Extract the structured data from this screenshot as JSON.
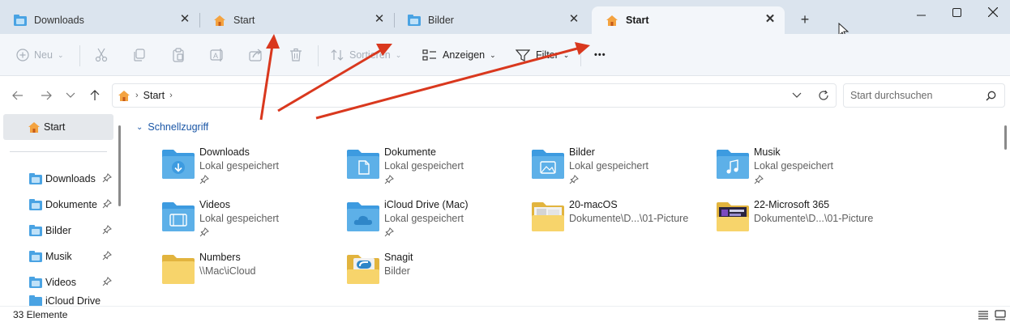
{
  "tabs": [
    {
      "label": "Downloads",
      "icon": "downloads-folder-icon",
      "active": false
    },
    {
      "label": "Start",
      "icon": "home-icon",
      "active": false
    },
    {
      "label": "Bilder",
      "icon": "pictures-folder-icon",
      "active": false
    },
    {
      "label": "Start",
      "icon": "home-icon",
      "active": true
    }
  ],
  "new_tab_label": "+",
  "toolbar": {
    "new_label": "Neu",
    "sort_label": "Sortieren",
    "view_label": "Anzeigen",
    "filter_label": "Filter",
    "more_label": "•••"
  },
  "address": {
    "crumbs": [
      "Start"
    ],
    "search_placeholder": "Start durchsuchen"
  },
  "sidebar": {
    "home_label": "Start",
    "items": [
      {
        "label": "Downloads",
        "pinned": true
      },
      {
        "label": "Dokumente",
        "pinned": true
      },
      {
        "label": "Bilder",
        "pinned": true
      },
      {
        "label": "Musik",
        "pinned": true
      },
      {
        "label": "Videos",
        "pinned": true
      },
      {
        "label": "iCloud Drive",
        "pinned": false
      }
    ]
  },
  "content": {
    "section_title": "Schnellzugriff",
    "tiles": [
      {
        "name": "Downloads",
        "sub": "Lokal gespeichert",
        "icon": "downloads-folder-icon",
        "pinned": true
      },
      {
        "name": "Dokumente",
        "sub": "Lokal gespeichert",
        "icon": "documents-folder-icon",
        "pinned": true
      },
      {
        "name": "Bilder",
        "sub": "Lokal gespeichert",
        "icon": "pictures-folder-icon",
        "pinned": true
      },
      {
        "name": "Musik",
        "sub": "Lokal gespeichert",
        "icon": "music-folder-icon",
        "pinned": true
      },
      {
        "name": "Videos",
        "sub": "Lokal gespeichert",
        "icon": "videos-folder-icon",
        "pinned": true
      },
      {
        "name": "iCloud Drive (Mac)",
        "sub": "Lokal gespeichert",
        "icon": "icloud-folder-icon",
        "pinned": true
      },
      {
        "name": "20-macOS",
        "sub": "Dokumente\\D...\\01-Picture",
        "icon": "thumbnail-folder-icon",
        "pinned": false
      },
      {
        "name": "22-Microsoft 365",
        "sub": "Dokumente\\D...\\01-Picture",
        "icon": "thumbnail-folder-icon",
        "pinned": false
      },
      {
        "name": "Numbers",
        "sub": "\\\\Mac\\iCloud",
        "icon": "folder-icon",
        "pinned": false
      },
      {
        "name": "Snagit",
        "sub": "Bilder",
        "icon": "snagit-folder-icon",
        "pinned": false
      }
    ]
  },
  "status": {
    "count_label": "33 Elemente"
  },
  "colors": {
    "titlebar": "#dbe4ee",
    "active_tab": "#f3f6fa",
    "accent_link": "#1a56a6",
    "arrow": "#d9381e",
    "folder": "#5db0e8"
  }
}
